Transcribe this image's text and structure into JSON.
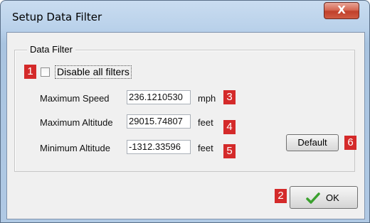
{
  "window": {
    "title": "Setup Data Filter",
    "close_glyph": "X"
  },
  "group": {
    "label": "Data Filter"
  },
  "disable_filters": {
    "label": "Disable all filters",
    "checked": false
  },
  "fields": {
    "max_speed": {
      "label": "Maximum Speed",
      "value": "236.1210530",
      "unit": "mph"
    },
    "max_altitude": {
      "label": "Maximum Altitude",
      "value": "29015.74807",
      "unit": "feet"
    },
    "min_altitude": {
      "label": "Minimum Altitude",
      "value": "-1312.33596",
      "unit": "feet"
    }
  },
  "buttons": {
    "default_label": "Default",
    "ok_label": "OK",
    "ok_icon": "checkmark-icon"
  },
  "markers": [
    "1",
    "2",
    "3",
    "4",
    "5",
    "6"
  ],
  "colors": {
    "marker": "#d42a2a",
    "check": "#3aa02e",
    "close": "#c0402a"
  }
}
